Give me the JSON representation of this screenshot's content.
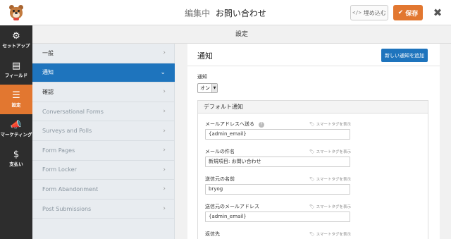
{
  "topbar": {
    "editing_label": "編集中",
    "form_name": "お問い合わせ",
    "embed_label": "埋め込む",
    "embed_icon": "</>",
    "save_label": "保存",
    "save_icon": "✔",
    "close_icon": "✖"
  },
  "sidebar": {
    "items": [
      {
        "label": "セットアップ",
        "icon": "⚙",
        "name": "setup"
      },
      {
        "label": "フィールド",
        "icon": "▤",
        "name": "fields"
      },
      {
        "label": "設定",
        "icon": "☰",
        "name": "settings"
      },
      {
        "label": "マーケティング",
        "icon": "📣",
        "name": "marketing"
      },
      {
        "label": "支払い",
        "icon": "$",
        "name": "payments"
      }
    ]
  },
  "settings_header": "設定",
  "subpanel": {
    "items": [
      {
        "label": "一般"
      },
      {
        "label": "通知"
      },
      {
        "label": "確認"
      },
      {
        "label": "Conversational Forms"
      },
      {
        "label": "Surveys and Polls"
      },
      {
        "label": "Form Pages"
      },
      {
        "label": "Form Locker"
      },
      {
        "label": "Form Abandonment"
      },
      {
        "label": "Post Submissions"
      }
    ],
    "chevron_right": "›",
    "chevron_down": "⌄"
  },
  "main": {
    "title": "通知",
    "add_button": "新しい通知を追加",
    "notif_label": "通知",
    "notif_value": "オン",
    "notif_arrow": "▼",
    "box_title": "デフォルト通知",
    "smart_tag_label": "スマートタグを表示",
    "smart_tag_icon": "🏷",
    "help_icon": "?",
    "fields": [
      {
        "label": "メールアドレスへ送る",
        "value": "{admin_email}"
      },
      {
        "label": "メールの件名",
        "value": "新規項目: お問い合わせ"
      },
      {
        "label": "送信元の名前",
        "value": "bryog"
      },
      {
        "label": "送信元のメールアドレス",
        "value": "{admin_email}"
      },
      {
        "label": "返信先",
        "value": ""
      }
    ]
  },
  "colors": {
    "accent_orange": "#e27730",
    "accent_blue": "#1e74bd",
    "sidebar_bg": "#2d2d2d"
  }
}
